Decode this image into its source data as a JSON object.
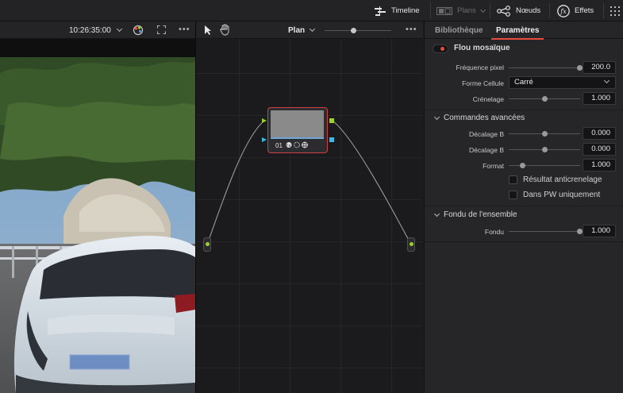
{
  "topbar": {
    "timeline_label": "Timeline",
    "plans_label": "Plans",
    "noeuds_label": "Nœuds",
    "effets_label": "Effets"
  },
  "viewer": {
    "timecode": "10:26:35:00"
  },
  "node_editor": {
    "mode_label": "Plan",
    "node_label": "01"
  },
  "inspector": {
    "tabs": [
      "Bibliothèque",
      "Paramètres"
    ],
    "active_tab": "Paramètres",
    "effect_name": "Flou mosaïque",
    "accent_color": "#e84a3d",
    "params": {
      "frequence_label": "Fréquence pixel",
      "frequence_value": "200.0",
      "forme_label": "Forme Cellule",
      "forme_value": "Carré",
      "crenelage_label": "Crénelage",
      "crenelage_value": "1.000"
    },
    "advanced": {
      "title": "Commandes avancées",
      "decalage1_label": "Décalage B",
      "decalage1_value": "0.000",
      "decalage2_label": "Décalage B",
      "decalage2_value": "0.000",
      "format_label": "Format",
      "format_value": "1.000",
      "check1_label": "Résultat anticrenelage",
      "check2_label": "Dans PW uniquement"
    },
    "fondu": {
      "title": "Fondu de l'ensemble",
      "fondu_label": "Fondu",
      "fondu_value": "1.000"
    }
  }
}
